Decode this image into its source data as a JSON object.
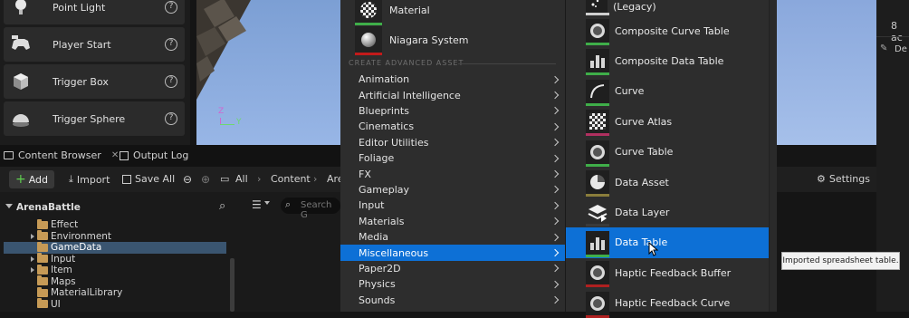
{
  "place_actors": [
    {
      "label": "Point Light",
      "icon": "light-bulb-icon"
    },
    {
      "label": "Player Start",
      "icon": "gamepad-icon"
    },
    {
      "label": "Trigger Box",
      "icon": "cube-icon"
    },
    {
      "label": "Trigger Sphere",
      "icon": "sphere-icon"
    }
  ],
  "viewport": {
    "axis_z": "Z",
    "axis_y": "Y"
  },
  "tabs": {
    "content_browser": "Content Browser",
    "output_log": "Output Log"
  },
  "toolbar": {
    "add": "Add",
    "import": "Import",
    "save_all": "Save All",
    "breadcrumb": [
      "All",
      "Content",
      "Are"
    ],
    "settings": "Settings"
  },
  "search": {
    "placeholder": "Search G"
  },
  "tree": {
    "root": "ArenaBattle",
    "items": [
      {
        "label": "Effect",
        "expandable": false,
        "selected": false
      },
      {
        "label": "Environment",
        "expandable": true,
        "selected": false
      },
      {
        "label": "GameData",
        "expandable": false,
        "selected": true
      },
      {
        "label": "Input",
        "expandable": true,
        "selected": false
      },
      {
        "label": "Item",
        "expandable": true,
        "selected": false
      },
      {
        "label": "Maps",
        "expandable": false,
        "selected": false
      },
      {
        "label": "MaterialLibrary",
        "expandable": false,
        "selected": false
      },
      {
        "label": "UI",
        "expandable": false,
        "selected": false
      }
    ]
  },
  "basic_assets": [
    {
      "label": "Material",
      "bar_color": "#3fae49"
    },
    {
      "label": "Niagara System",
      "bar_color": "#c21a1a"
    }
  ],
  "section_title": "CREATE ADVANCED ASSET",
  "categories": [
    {
      "label": "Animation",
      "selected": false
    },
    {
      "label": "Artificial Intelligence",
      "selected": false
    },
    {
      "label": "Blueprints",
      "selected": false
    },
    {
      "label": "Cinematics",
      "selected": false
    },
    {
      "label": "Editor Utilities",
      "selected": false
    },
    {
      "label": "Foliage",
      "selected": false
    },
    {
      "label": "FX",
      "selected": false
    },
    {
      "label": "Gameplay",
      "selected": false
    },
    {
      "label": "Input",
      "selected": false
    },
    {
      "label": "Materials",
      "selected": false
    },
    {
      "label": "Media",
      "selected": false
    },
    {
      "label": "Miscellaneous",
      "selected": true
    },
    {
      "label": "Paper2D",
      "selected": false
    },
    {
      "label": "Physics",
      "selected": false
    },
    {
      "label": "Sounds",
      "selected": false
    }
  ],
  "misc_assets": [
    {
      "label": "Cascade Particle System (Legacy)",
      "icon": "particle-icon",
      "bar_color": "#cfcfcf",
      "selected": false
    },
    {
      "label": "Composite Curve Table",
      "icon": "sphere-icon",
      "bar_color": "#3fae49",
      "selected": false
    },
    {
      "label": "Composite Data Table",
      "icon": "bar-chart-icon",
      "bar_color": "#3fae49",
      "selected": false
    },
    {
      "label": "Curve",
      "icon": "curve-icon",
      "bar_color": "#3fae49",
      "selected": false
    },
    {
      "label": "Curve Atlas",
      "icon": "checker-icon",
      "bar_color": "#b03060",
      "selected": false
    },
    {
      "label": "Curve Table",
      "icon": "sphere-icon",
      "bar_color": "#3fae49",
      "selected": false
    },
    {
      "label": "Data Asset",
      "icon": "pie-icon",
      "bar_color": "#8a7d3b",
      "selected": false
    },
    {
      "label": "Data Layer",
      "icon": "layers-icon",
      "bar_color": "#3a3a3a",
      "selected": false
    },
    {
      "label": "Data Table",
      "icon": "bar-chart-icon",
      "bar_color": "#3fae49",
      "selected": true
    },
    {
      "label": "Haptic Feedback Buffer",
      "icon": "sphere-icon",
      "bar_color": "#b02020",
      "selected": false
    },
    {
      "label": "Haptic Feedback Curve",
      "icon": "sphere-icon",
      "bar_color": "#b02020",
      "selected": false
    }
  ],
  "tooltip": "Imported spreadsheet table.",
  "right_panel": {
    "text1": "8 ac",
    "text2": "De"
  }
}
